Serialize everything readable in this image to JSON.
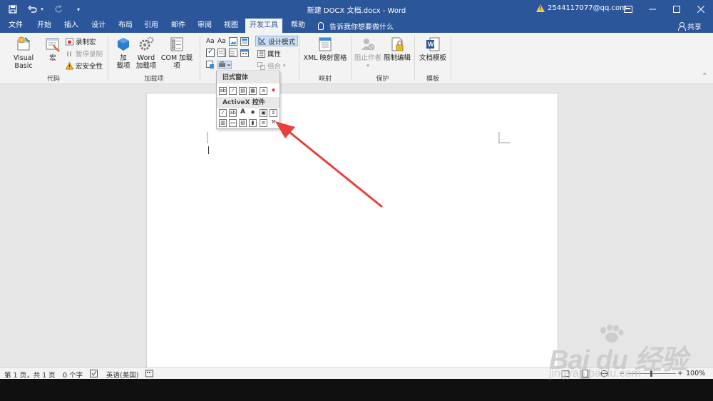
{
  "titlebar": {
    "title": "新建 DOCX 文档.docx - Word",
    "account": "2544117077@qq.com",
    "qat_save": "save-icon",
    "qat_undo": "undo-icon",
    "qat_redo": "redo-icon",
    "qat_customize": "customize-qat-icon"
  },
  "tabs": [
    "文件",
    "开始",
    "插入",
    "设计",
    "布局",
    "引用",
    "邮件",
    "审阅",
    "视图",
    "开发工具",
    "帮助"
  ],
  "active_tab": "开发工具",
  "tellme": "告诉我你想要做什么",
  "share": "共享",
  "ribbon": {
    "code": {
      "label": "代码",
      "visual_basic": "Visual Basic",
      "macros": "宏",
      "record_macro": "录制宏",
      "pause_recording": "暂停录制",
      "macro_security": "宏安全性"
    },
    "addins": {
      "label": "加载项",
      "addins": "加\n载项",
      "addins_l1": "加",
      "addins_l2": "载项",
      "word_addins_l1": "Word",
      "word_addins_l2": "加载项",
      "com_addins": "COM 加载项"
    },
    "controls": {
      "design_mode": "设计模式",
      "properties": "属性",
      "group": "组合"
    },
    "mapping": {
      "label": "映射",
      "xml_pane": "XML 映射窗格"
    },
    "protect": {
      "label": "保护",
      "block_authors": "阻止作者",
      "restrict_editing": "限制编辑"
    },
    "templates": {
      "label": "模板",
      "document_template": "文档模板"
    }
  },
  "dropdown": {
    "legacy_header": "旧式窗体",
    "activex_header": "ActiveX 控件",
    "label_glyph": "A"
  },
  "status": {
    "page": "第 1 页，共 1 页",
    "words": "0 个字",
    "language": "英语(美国)",
    "zoom": "100%"
  },
  "watermark": {
    "main": "Bai du 经验",
    "sub": "jingyan.baidu.com"
  },
  "colors": {
    "accent": "#2b579a",
    "arrow": "#e8413c"
  }
}
